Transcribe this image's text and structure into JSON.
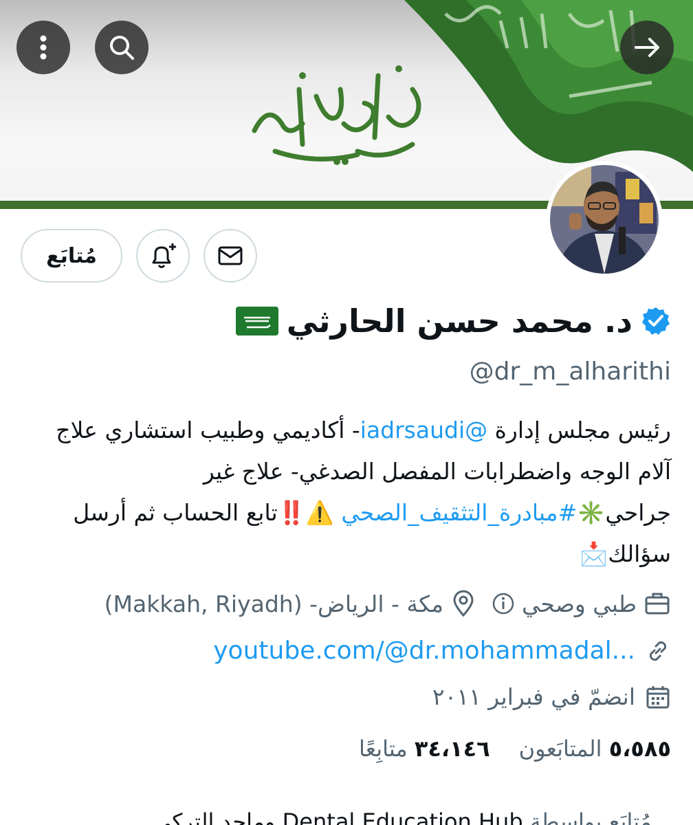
{
  "header": {
    "banner_calligraphy": "دام عزك يا وطن",
    "flag_script": "لا إله إلا الله محمد رسول الله"
  },
  "profile": {
    "follow_label": "مُتابَع",
    "name": "د. محمد حسن الحارثي",
    "name_flag": "🇸🇦",
    "handle": "@dr_m_alharithi",
    "bio": {
      "part1": "رئيس مجلس إدارة ",
      "mention": "@iadrsaudi",
      "part2": "- أكاديمي وطبيب استشاري علاج آلام الوجه واضطرابات المفصل الصدغي- علاج غير جراحي",
      "emoji1": "✳️",
      "hashtag": "#مبادرة_التثقيف_الصحي",
      "emoji2": " ⚠️‼️",
      "part3": "تابع الحساب ثم أرسل سؤالك",
      "emoji3": "📩"
    },
    "category": "طبي وصحي",
    "location": "مكة - الرياض- (Makkah, Riyadh)",
    "website": "youtube.com/@dr.mohammadal...",
    "joined": "انضمّ في فبراير ٢٠١١",
    "followers_count": "٣٤،١٤٦",
    "followers_label": "متابِعًا",
    "following_count": "٥،٥٨٥",
    "following_label": "المتابَعون",
    "followed_by_prefix": "مُتابَع بواسطة",
    "followed_by_names": "Dental Education Hub",
    "followed_by_more": "وماجد التركي"
  },
  "colors": {
    "accent": "#1d9bf0",
    "banner_green": "#3f6f2c",
    "muted": "#536471"
  }
}
